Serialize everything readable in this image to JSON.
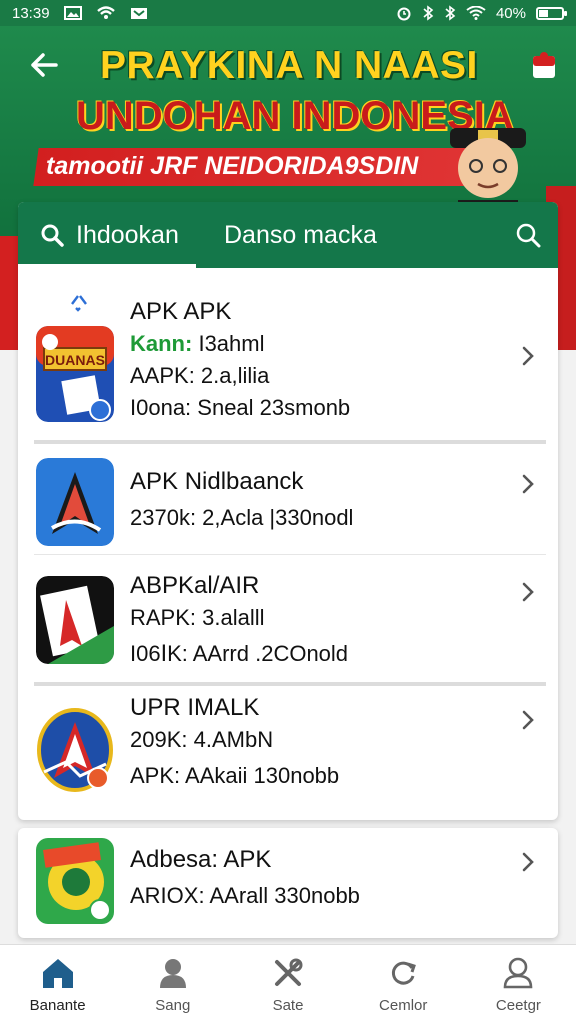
{
  "status_bar": {
    "time": "13:39",
    "battery": "40%",
    "battery_level": 0.4
  },
  "banner": {
    "title_line1": "PRAYKINA N NAASI",
    "title_line2": "UNDOHAN INDONESIA",
    "subtitle": "tamootii JRF NEIDORIDA9SDIN"
  },
  "tabs": {
    "active": "Ihdookan",
    "second": "Danso macka"
  },
  "apps": [
    {
      "name": "APK APK",
      "line1_label": "Kann:",
      "line1_value": "I3ahml",
      "line2": "AAPK: 2.a,lilia",
      "line3": "I0ona: Sneal 23smonb"
    },
    {
      "name": "APK Nidlbaanck",
      "line2": "2370k: 2,Acla |330nodl"
    },
    {
      "name": "ABPKal/AIR",
      "line2": "RAPK: 3.alalll",
      "line3": "I06ⅠK: AArrd .2COnold"
    },
    {
      "name": "UPR IMALK",
      "line2": "209K: 4.AMbN",
      "line3": "APK: AAkaii 130nobb"
    },
    {
      "name": "Adbesa: APK",
      "line2": "ARIOX: AArall 330nobb"
    }
  ],
  "nav": [
    {
      "label": "Banante",
      "icon": "home-icon"
    },
    {
      "label": "Sang",
      "icon": "person-icon"
    },
    {
      "label": "Sate",
      "icon": "tools-icon"
    },
    {
      "label": "Cemlor",
      "icon": "refresh-icon"
    },
    {
      "label": "Ceetgr",
      "icon": "account-icon"
    }
  ],
  "colors": {
    "brand_green": "#14774a",
    "banner_yellow": "#ffd21f",
    "accent_red": "#c81b1b"
  }
}
